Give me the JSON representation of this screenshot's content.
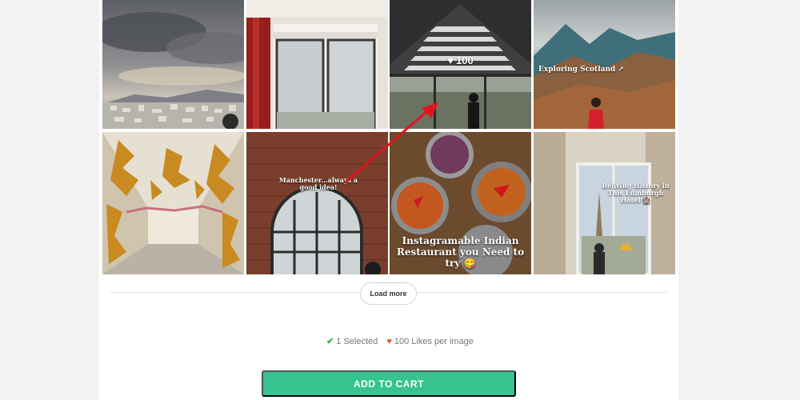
{
  "gallery": {
    "tiles": [
      {
        "caption": ""
      },
      {
        "caption": ""
      },
      {
        "caption": "",
        "likes": "100"
      },
      {
        "caption": "Exploring Scotland ↗"
      },
      {
        "caption": ""
      },
      {
        "caption": "Manchester...always a good idea!"
      },
      {
        "caption": "Instagramable Indian Restaurant you Need to try 😋"
      },
      {
        "caption": "Reliving History in This Edinburgh Hotel 🏰"
      }
    ]
  },
  "load_more_label": "Load more",
  "summary": {
    "selected": "1 Selected",
    "likes": "100 Likes per image"
  },
  "cart_label": "ADD TO CART",
  "colors": {
    "accent": "#36c38f",
    "check": "#3aa83a",
    "heart": "#e8542f",
    "annotation_arrow": "#e0141c"
  }
}
